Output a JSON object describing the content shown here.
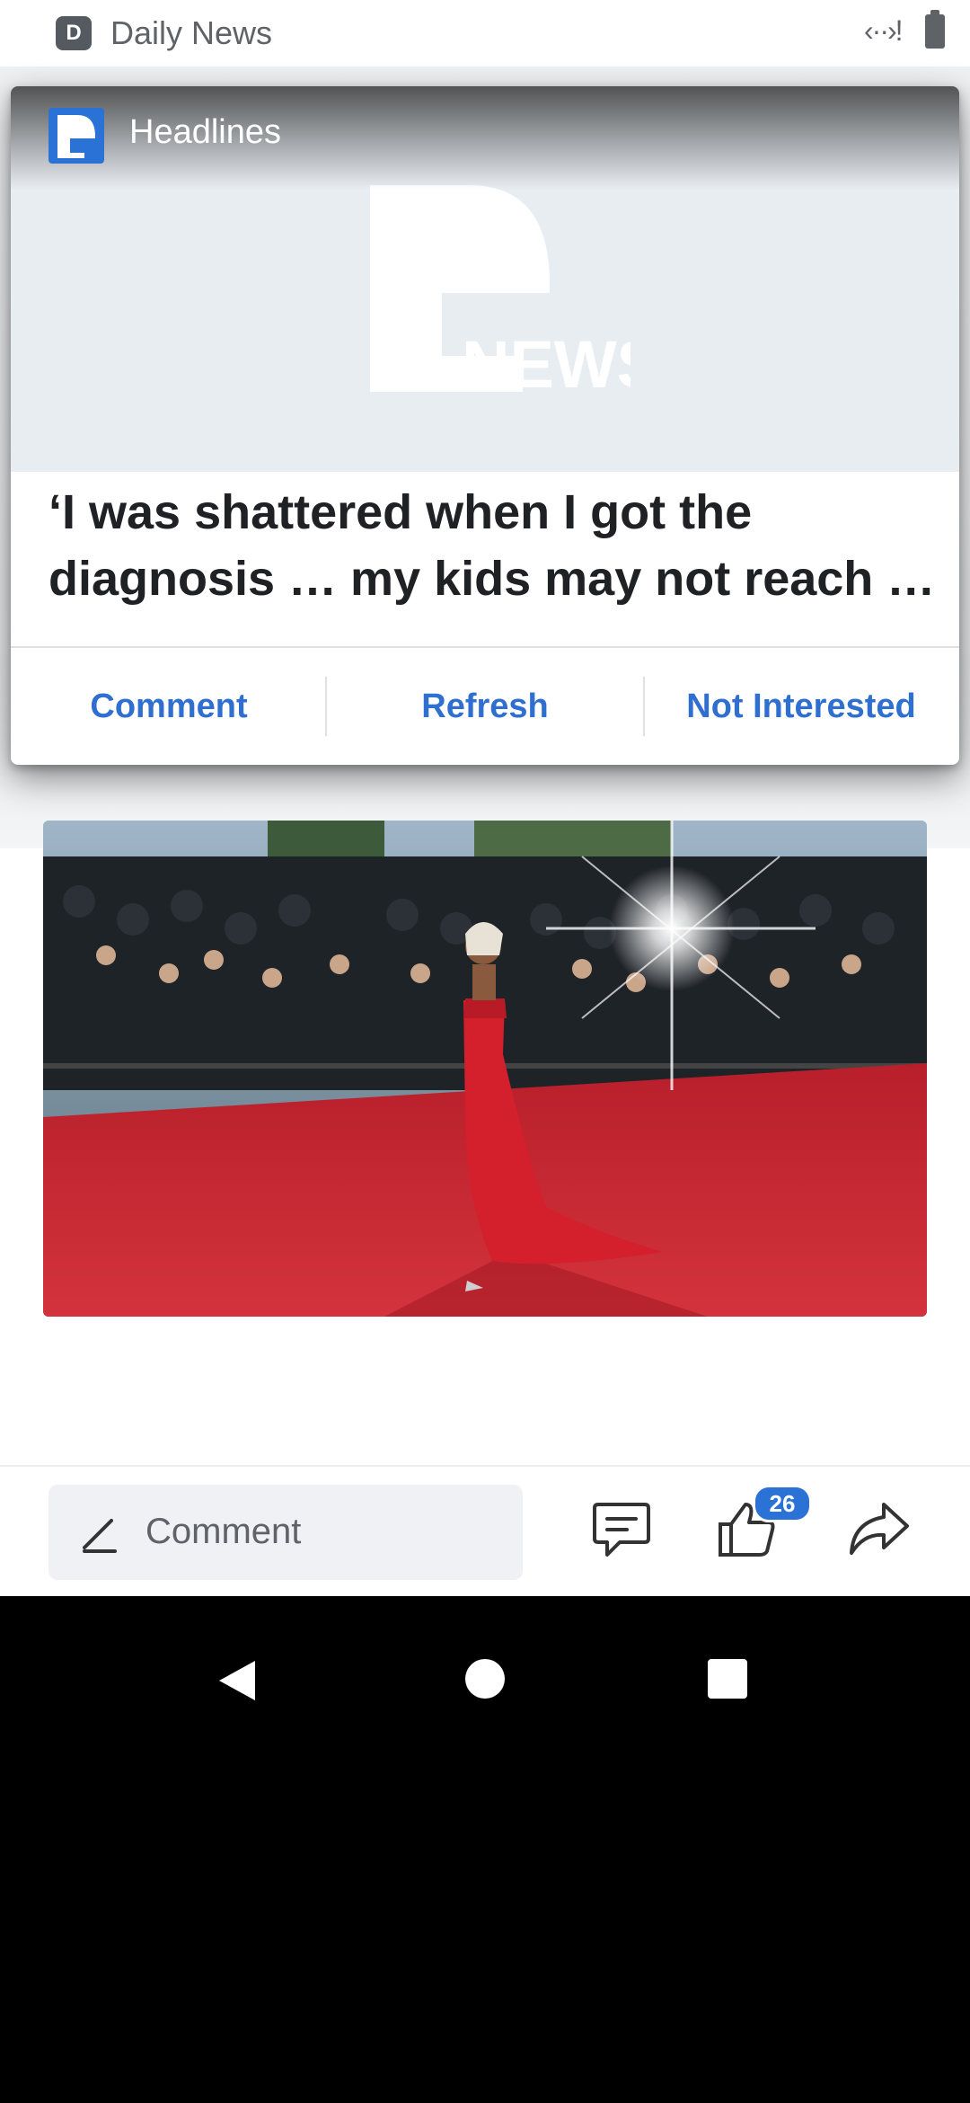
{
  "status_bar": {
    "app_badge": "D",
    "app_name": "Daily News",
    "network_glyph": "‹··›!"
  },
  "notification": {
    "app_label": "Headlines",
    "hero_logo_text": "NEWS",
    "title": "‘I was shattered when I got the diagnosis … my kids may not reach …",
    "actions": [
      {
        "label": "Comment"
      },
      {
        "label": "Refresh"
      },
      {
        "label": "Not Interested"
      }
    ]
  },
  "bottom_bar": {
    "comment_placeholder": "Comment",
    "like_count": "26"
  },
  "colors": {
    "accent": "#2f6fd0",
    "badge": "#2b72d6",
    "red_carpet": "#c8232c"
  },
  "icons": [
    "pencil-icon",
    "comment-icon",
    "thumbs-up-icon",
    "share-icon",
    "back-icon",
    "home-icon",
    "recents-icon"
  ]
}
